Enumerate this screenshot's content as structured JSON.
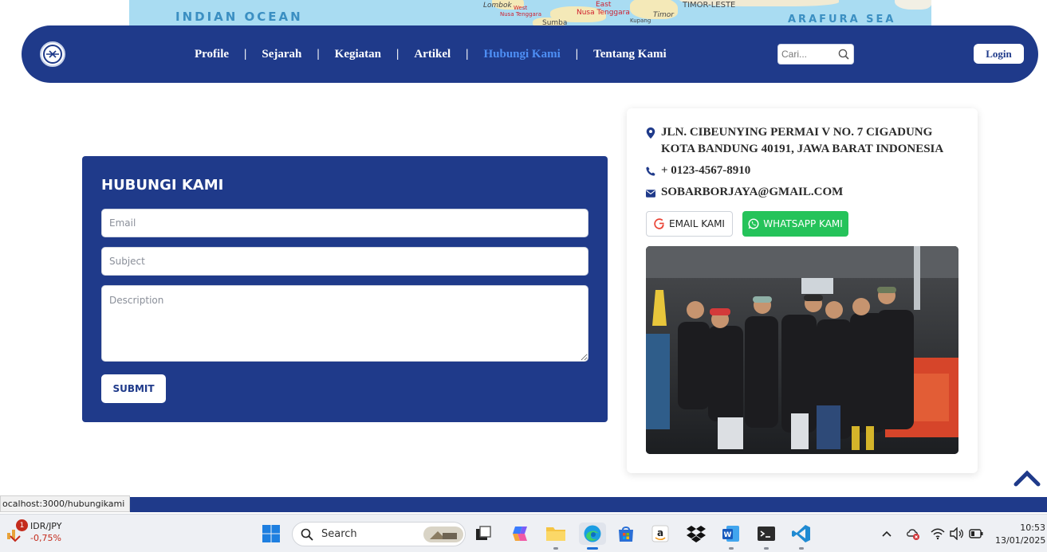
{
  "map_strip": {
    "ocean_left": "INDIAN  OCEAN",
    "ocean_right": "ARAFURA  SEA",
    "places": [
      "Lombok",
      "West",
      "Nusa Tenggara",
      "East",
      "Nusa Tenggara",
      "Timor",
      "TIMOR-LESTE",
      "Sumba",
      "Kupang"
    ]
  },
  "navbar": {
    "links": [
      {
        "label": "Profile"
      },
      {
        "label": "Sejarah"
      },
      {
        "label": "Kegiatan"
      },
      {
        "label": "Artikel"
      },
      {
        "label": "Hubungi Kami",
        "active": true
      },
      {
        "label": "Tentang Kami"
      }
    ],
    "separator": "|",
    "search_placeholder": "Cari...",
    "login_label": "Login"
  },
  "contact_form": {
    "title": "HUBUNGI KAMI",
    "email_placeholder": "Email",
    "subject_placeholder": "Subject",
    "description_placeholder": "Description",
    "submit_label": "SUBMIT"
  },
  "contact_info": {
    "address_line1": "JLN. CIBEUNYING PERMAI V NO. 7 CIGADUNG",
    "address_line2": "KOTA BANDUNG 40191, JAWA BARAT INDONESIA",
    "phone": "+ 0123-4567-8910",
    "email": "SOBARBORJAYA@GMAIL.COM",
    "email_button": "EMAIL KAMI",
    "whatsapp_button": "WHATSAPP KAMI"
  },
  "colors": {
    "primary": "#1f3a8a",
    "active_link": "#4e8ff5",
    "whatsapp": "#25c35a"
  },
  "status_bar": {
    "url": "ocalhost:3000/hubungikami"
  },
  "taskbar": {
    "widget_title": "IDR/JPY",
    "widget_value": "-0,75%",
    "widget_badge": "1",
    "search_label": "Search",
    "time": "10:53",
    "date": "13/01/2025"
  }
}
